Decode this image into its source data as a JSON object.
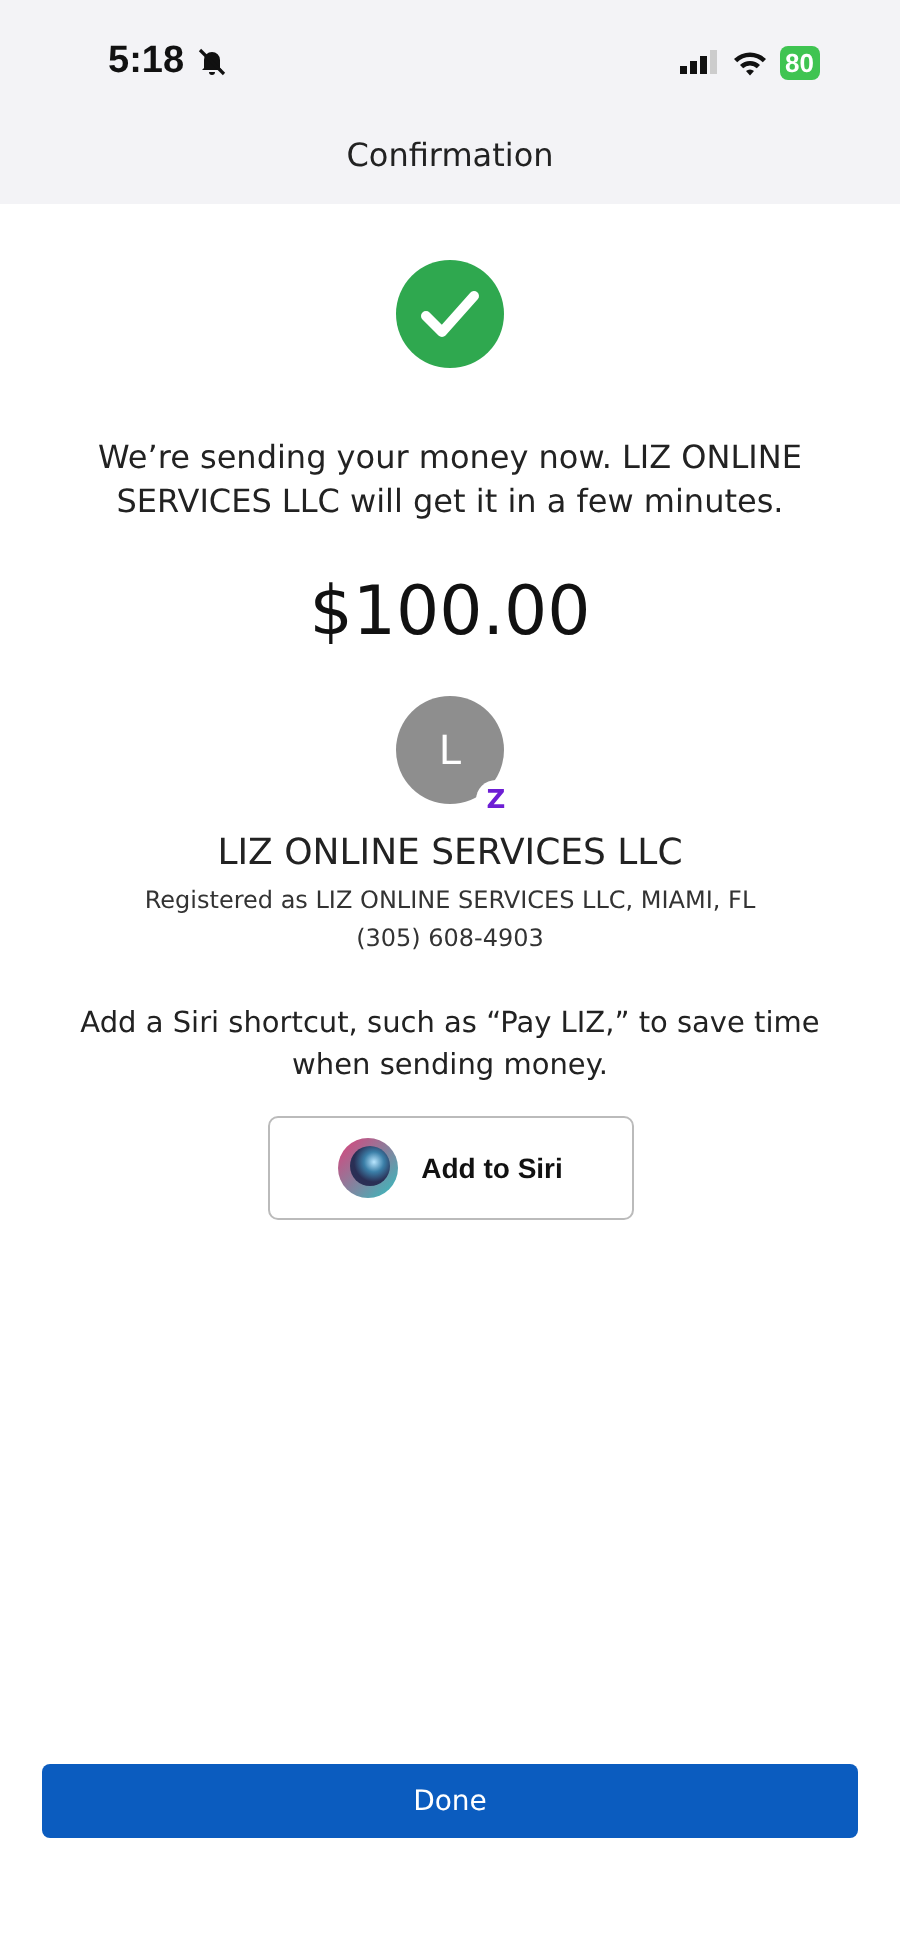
{
  "status_bar": {
    "time": "5:18",
    "battery": "80"
  },
  "header": {
    "title": "Confirmation"
  },
  "message": "We’re sending your money now. LIZ ONLINE SERVICES LLC will get it in a few minutes.",
  "amount": "$100.00",
  "recipient": {
    "initial": "L",
    "badge": "Z",
    "name": "LIZ ONLINE SERVICES LLC",
    "registered": "Registered as LIZ ONLINE SERVICES LLC, MIAMI, FL",
    "phone": "(305) 608-4903"
  },
  "siri": {
    "text": "Add a Siri shortcut, such as “Pay LIZ,” to save time when sending money.",
    "button": "Add to Siri"
  },
  "done_button": "Done"
}
